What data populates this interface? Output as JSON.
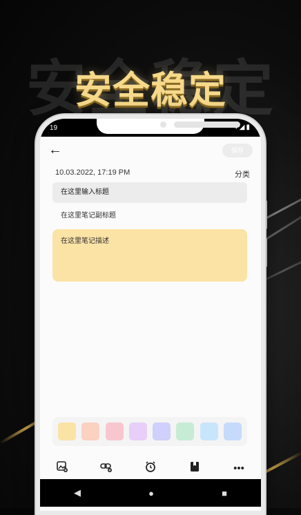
{
  "banner": {
    "title": "安全稳定",
    "title_shadow": "安全稳定"
  },
  "status": {
    "time": "19",
    "icons": "▾◢▮"
  },
  "editor": {
    "save_label": "保存",
    "datetime": "10.03.2022, 17:19 PM",
    "category_label": "分类",
    "title_placeholder": "在这里输入标题",
    "subtitle_placeholder": "在这里笔记副标题",
    "description_placeholder": "在这里笔记描述",
    "description_color": "#fbe3a6"
  },
  "swatches": [
    "#fbe3a6",
    "#fbd1c2",
    "#f8c6cf",
    "#e7cff8",
    "#cfd0fb",
    "#c6ecd5",
    "#c8e6fb",
    "#c6dbfb"
  ],
  "toolbar": {
    "items": [
      "image-add-icon",
      "link-add-icon",
      "alarm-icon",
      "bookmark-icon",
      "more-icon"
    ]
  },
  "nav": {
    "back": "◀",
    "home": "●",
    "recents": "■"
  }
}
